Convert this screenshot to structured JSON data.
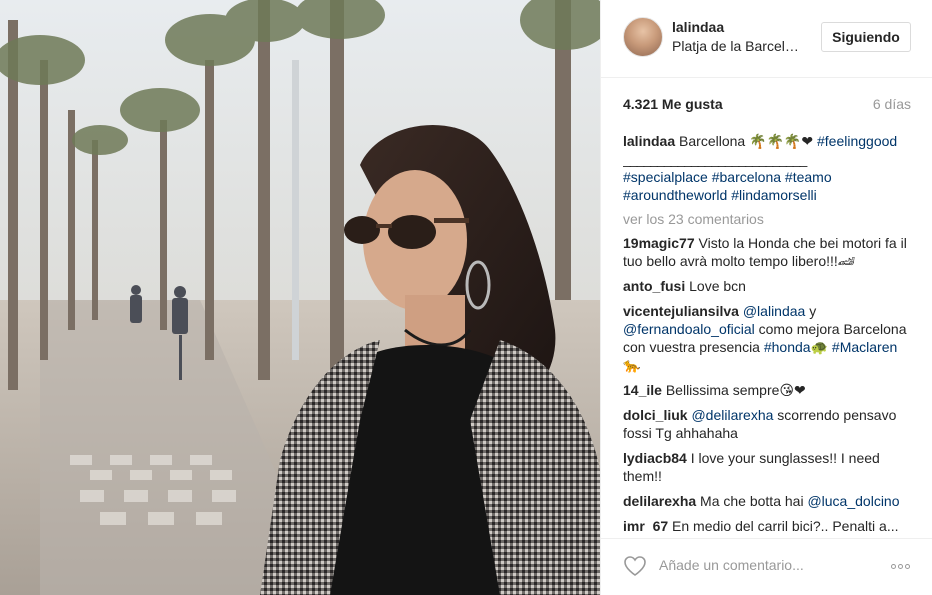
{
  "post": {
    "username": "lalindaa",
    "location": "Platja de la Barcel…",
    "follow_label": "Siguiendo",
    "likes": "4.321 Me gusta",
    "time_ago": "6 días"
  },
  "caption": {
    "username": "lalindaa",
    "text": "Barcellona 🌴🌴🌴❤",
    "tag_feelinggood": "#feelinggood",
    "divider": "___________________________",
    "tags_line1": [
      "#specialplace",
      "#barcelona",
      "#teamo"
    ],
    "tags_line2": [
      "#aroundtheworld",
      "#lindamorselli"
    ]
  },
  "view_all_comments": "ver los 23 comentarios",
  "comments": [
    {
      "user": "19magic77",
      "text": "Visto la Honda che bei motori fa il tuo bello avrà molto tempo libero!!!🏎"
    },
    {
      "user": "anto_fusi",
      "text": "Love bcn"
    },
    {
      "user": "vicentejuliansilva",
      "mention1": "@lalindaa",
      "text1": "y",
      "mention2": "@fernandoalo_oficial",
      "text2": "como mejora Barcelona con vuestra presencia",
      "tag1": "#honda",
      "emoji1": "🐢",
      "tag2": "#Maclaren",
      "emoji2": "🐆"
    },
    {
      "user": "14_ile",
      "text": "Bellissima sempre😘❤"
    },
    {
      "user": "dolci_liuk",
      "mention": "@delilarexha",
      "text": "scorrendo pensavo fossi Tg ahhahaha"
    },
    {
      "user": "lydiacb84",
      "text": "I love your sunglasses!! I need them!!"
    },
    {
      "user": "delilarexha",
      "text": "Ma che botta hai",
      "mention": "@luca_dolcino"
    },
    {
      "user": "imr_67",
      "text": "En medio del carril bici?.. Penalti a..."
    }
  ],
  "comment_input_placeholder": "Añade un comentario...",
  "icons": {
    "like": "heart-outline-icon",
    "more": "more-options-icon"
  },
  "colors": {
    "hashtag": "#003569",
    "muted": "#999999",
    "text": "#262626",
    "border": "#efefef"
  }
}
